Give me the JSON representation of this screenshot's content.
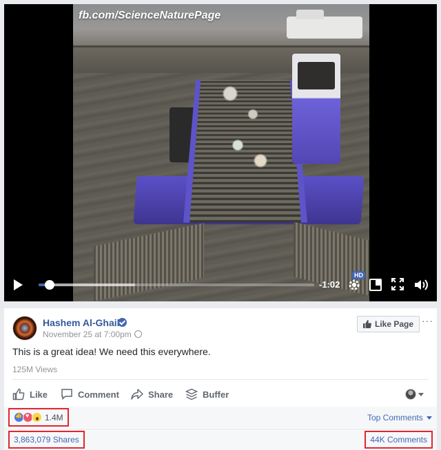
{
  "video": {
    "watermark": "fb.com/ScienceNaturePage",
    "progress_played_fraction": 0.04,
    "progress_loaded_fraction": 0.35,
    "time_remaining": "-1:02",
    "quality_badge": "HD",
    "icons": [
      "play-icon",
      "gear-icon",
      "miniplayer-icon",
      "fullscreen-icon",
      "volume-icon"
    ]
  },
  "post": {
    "author": "Hashem Al-Ghaili",
    "date": "November 25 at 7:00pm ·",
    "like_page_label": "Like Page",
    "more_options": "···",
    "text": "This is a great idea! We need this everywhere.",
    "views": "125M Views"
  },
  "actions": {
    "like": "Like",
    "comment": "Comment",
    "share": "Share",
    "buffer": "Buffer"
  },
  "stats": {
    "reaction_count": "1.4M",
    "top_comments": "Top Comments",
    "shares": "3,863,079 Shares",
    "comments": "44K Comments"
  },
  "colors": {
    "link_blue": "#365899",
    "fb_blue": "#4267b2",
    "highlight_red": "#e0262f",
    "muted_gray": "#90949c"
  }
}
